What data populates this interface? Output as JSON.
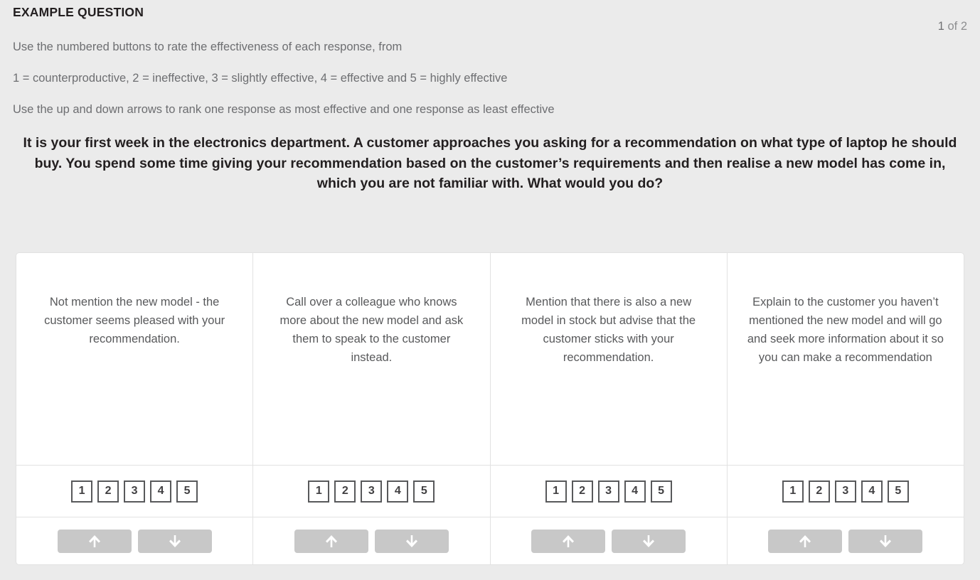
{
  "header": {
    "title": "EXAMPLE QUESTION",
    "page_current": "1",
    "page_suffix": " of 2"
  },
  "instructions": [
    "Use the numbered buttons to rate the effectiveness of each response, from",
    "1 = counterproductive, 2 = ineffective, 3 = slightly effective, 4 = effective and 5 = highly effective",
    "Use the up and down arrows to rank one response as most effective and one response as least effective"
  ],
  "question": {
    "stem": "It is your first week in the electronics department. A customer approaches you asking for a recommendation on what type of laptop he should buy. You spend some time giving your recommendation based on the customer’s requirements and then realise a new model has come in, which you are not familiar with. What would you do?"
  },
  "rating_scale": {
    "options": [
      "1",
      "2",
      "3",
      "4",
      "5"
    ]
  },
  "rank_controls": {
    "up_icon": "arrow-up-icon",
    "down_icon": "arrow-down-icon"
  },
  "answers": [
    {
      "text": "Not mention the new model - the customer seems pleased with your recommendation."
    },
    {
      "text": "Call over a colleague who knows more about the new model and ask them to speak to the customer instead."
    },
    {
      "text": "Mention that there is also a new model in stock but advise that the customer sticks with your recommendation."
    },
    {
      "text": "Explain to the customer you haven’t mentioned the new model and will go and seek more information about it so you can make a recommendation"
    }
  ],
  "colors": {
    "page_background": "#ebebeb",
    "panel_background": "#ffffff",
    "panel_border": "#e2e2e2",
    "body_text": "#6d6e71",
    "heading_text": "#231f20",
    "rating_border": "#58595b",
    "rank_button": "#c8c8c8",
    "rank_arrow": "#ffffff"
  }
}
